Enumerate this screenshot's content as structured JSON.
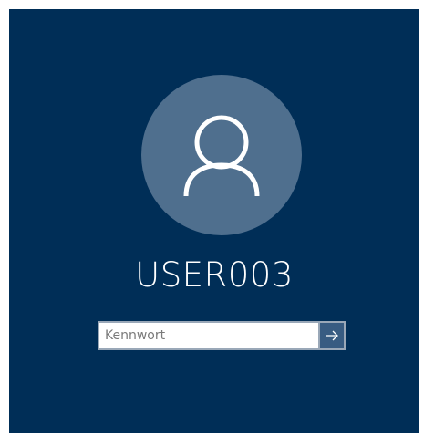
{
  "login": {
    "username": "USER003",
    "password_placeholder": "Kennwort",
    "password_value": "",
    "avatar_icon": "user-silhouette-icon",
    "submit_icon": "arrow-right-icon"
  },
  "colors": {
    "background": "#002e57",
    "avatar_circle": "#4f6f8e",
    "submit_button": "#385c82"
  }
}
